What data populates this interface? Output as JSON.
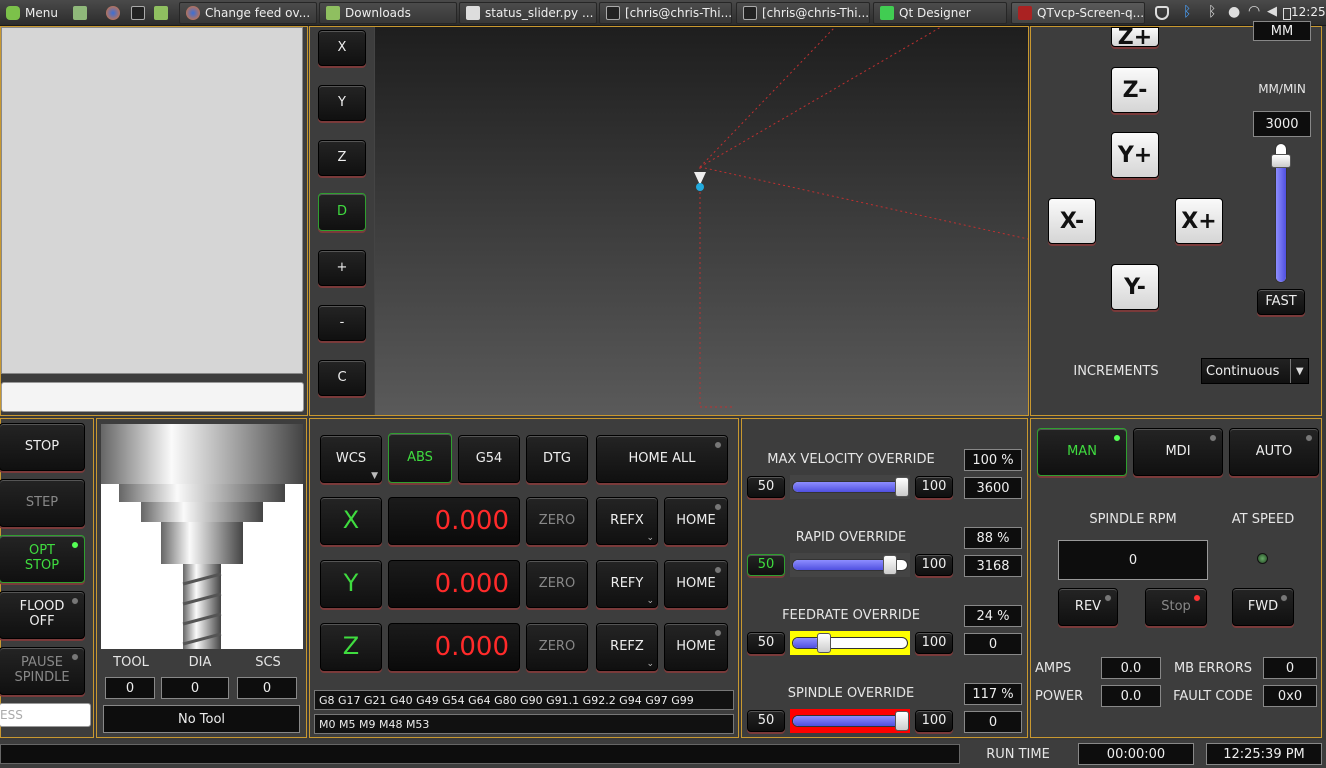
{
  "taskbar": {
    "menu_label": "Menu",
    "windows": [
      {
        "label": "Change feed ov..."
      },
      {
        "label": "Downloads"
      },
      {
        "label": "status_slider.py ..."
      },
      {
        "label": "[chris@chris-Thi..."
      },
      {
        "label": "[chris@chris-Thi..."
      },
      {
        "label": "Qt Designer"
      },
      {
        "label": "QTvcp-Screen-q..."
      }
    ],
    "clock": "12:25"
  },
  "view_buttons": [
    "X",
    "Y",
    "Z",
    "D",
    "+",
    "-",
    "C"
  ],
  "jog": {
    "units": "MM",
    "rate_units": "MM/MIN",
    "rate_value": "3000",
    "rate_fraction": 0.92,
    "fast_label": "FAST",
    "increments_label": "INCREMENTS",
    "increments_value": "Continuous",
    "buttons": {
      "zplus": "Z+",
      "zminus": "Z-",
      "yplus": "Y+",
      "yminus": "Y-",
      "xminus": "X-",
      "xplus": "X+"
    }
  },
  "left_buttons": {
    "stop": "STOP",
    "step": "STEP",
    "opt_stop": "OPT\nSTOP",
    "flood_off": "FLOOD\nOFF",
    "pause_spindle": "PAUSE\nSPINDLE"
  },
  "address_placeholder": "ESS",
  "tool": {
    "tool_label": "TOOL",
    "dia_label": "DIA",
    "scs_label": "SCS",
    "tool_value": "0",
    "dia_value": "0",
    "scs_value": "0",
    "name": "No Tool"
  },
  "dro": {
    "wcs": "WCS",
    "abs": "ABS",
    "g54": "G54",
    "dtg": "DTG",
    "home_all": "HOME ALL",
    "zero": "ZERO",
    "home": "HOME",
    "axes": [
      {
        "name": "X",
        "value": "0.000",
        "ref": "REFX"
      },
      {
        "name": "Y",
        "value": "0.000",
        "ref": "REFY"
      },
      {
        "name": "Z",
        "value": "0.000",
        "ref": "REFZ"
      }
    ],
    "gcodes": "G8 G17 G21 G40 G49 G54 G64 G80 G90 G91.1 G92.2 G94 G97 G99",
    "mcodes": "M0 M5 M9 M48 M53"
  },
  "overrides": [
    {
      "label": "MAX VELOCITY OVERRIDE",
      "min": "50",
      "max": "100",
      "percent": "100 %",
      "value": "3600",
      "fraction": 1.0,
      "color": "#5050e0"
    },
    {
      "label": "RAPID OVERRIDE",
      "min": "50",
      "max": "100",
      "percent": "88 %",
      "value": "3168",
      "fraction": 0.88,
      "color": "#5050e0"
    },
    {
      "label": "FEEDRATE OVERRIDE",
      "min": "50",
      "max": "100",
      "percent": "24 %",
      "value": "0",
      "fraction": 0.24,
      "color": "#ffff00"
    },
    {
      "label": "SPINDLE OVERRIDE",
      "min": "50",
      "max": "100",
      "percent": "117 %",
      "value": "0",
      "fraction": 1.17,
      "color": "#ff0000"
    }
  ],
  "modes": {
    "man": "MAN",
    "mdi": "MDI",
    "auto": "AUTO"
  },
  "spindle": {
    "rpm_label": "SPINDLE RPM",
    "at_speed_label": "AT SPEED",
    "rpm_value": "0",
    "rev": "REV",
    "stop": "Stop",
    "fwd": "FWD"
  },
  "stats": {
    "amps_label": "AMPS",
    "amps_value": "0.0",
    "power_label": "POWER",
    "power_value": "0.0",
    "mb_errors_label": "MB ERRORS",
    "mb_errors_value": "0",
    "fault_code_label": "FAULT CODE",
    "fault_code_value": "0x0"
  },
  "status_bar": {
    "run_time_label": "RUN TIME",
    "run_time": "00:00:00",
    "clock": "12:25:39 PM"
  },
  "colors": {
    "accent_border": "#c89830",
    "dro_red": "#ff2a2a",
    "active_green": "#3fdc3f"
  }
}
